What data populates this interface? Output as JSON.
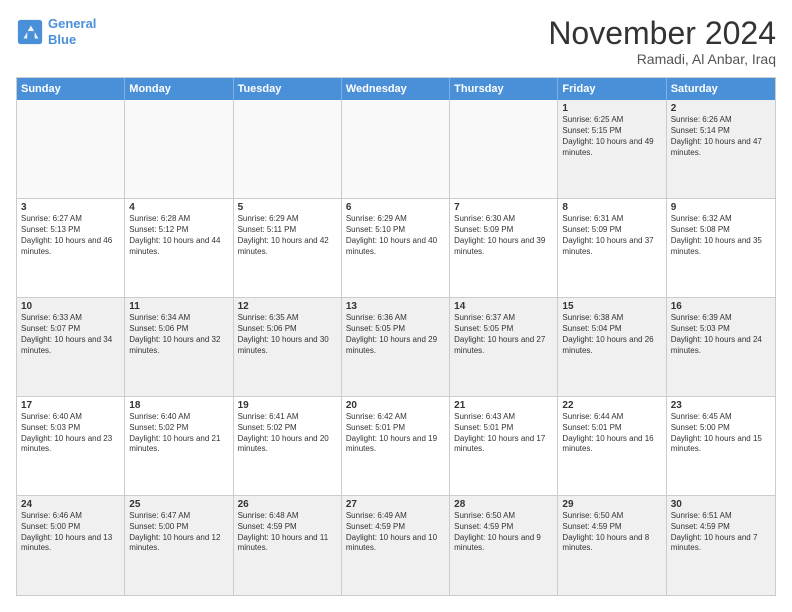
{
  "header": {
    "logo_line1": "General",
    "logo_line2": "Blue",
    "month_title": "November 2024",
    "location": "Ramadi, Al Anbar, Iraq"
  },
  "weekdays": [
    "Sunday",
    "Monday",
    "Tuesday",
    "Wednesday",
    "Thursday",
    "Friday",
    "Saturday"
  ],
  "weeks": [
    [
      {
        "day": "",
        "empty": true
      },
      {
        "day": "",
        "empty": true
      },
      {
        "day": "",
        "empty": true
      },
      {
        "day": "",
        "empty": true
      },
      {
        "day": "",
        "empty": true
      },
      {
        "day": "1",
        "rise": "6:25 AM",
        "set": "5:15 PM",
        "daylight": "10 hours and 49 minutes."
      },
      {
        "day": "2",
        "rise": "6:26 AM",
        "set": "5:14 PM",
        "daylight": "10 hours and 47 minutes."
      }
    ],
    [
      {
        "day": "3",
        "rise": "6:27 AM",
        "set": "5:13 PM",
        "daylight": "10 hours and 46 minutes."
      },
      {
        "day": "4",
        "rise": "6:28 AM",
        "set": "5:12 PM",
        "daylight": "10 hours and 44 minutes."
      },
      {
        "day": "5",
        "rise": "6:29 AM",
        "set": "5:11 PM",
        "daylight": "10 hours and 42 minutes."
      },
      {
        "day": "6",
        "rise": "6:29 AM",
        "set": "5:10 PM",
        "daylight": "10 hours and 40 minutes."
      },
      {
        "day": "7",
        "rise": "6:30 AM",
        "set": "5:09 PM",
        "daylight": "10 hours and 39 minutes."
      },
      {
        "day": "8",
        "rise": "6:31 AM",
        "set": "5:09 PM",
        "daylight": "10 hours and 37 minutes."
      },
      {
        "day": "9",
        "rise": "6:32 AM",
        "set": "5:08 PM",
        "daylight": "10 hours and 35 minutes."
      }
    ],
    [
      {
        "day": "10",
        "rise": "6:33 AM",
        "set": "5:07 PM",
        "daylight": "10 hours and 34 minutes."
      },
      {
        "day": "11",
        "rise": "6:34 AM",
        "set": "5:06 PM",
        "daylight": "10 hours and 32 minutes."
      },
      {
        "day": "12",
        "rise": "6:35 AM",
        "set": "5:06 PM",
        "daylight": "10 hours and 30 minutes."
      },
      {
        "day": "13",
        "rise": "6:36 AM",
        "set": "5:05 PM",
        "daylight": "10 hours and 29 minutes."
      },
      {
        "day": "14",
        "rise": "6:37 AM",
        "set": "5:05 PM",
        "daylight": "10 hours and 27 minutes."
      },
      {
        "day": "15",
        "rise": "6:38 AM",
        "set": "5:04 PM",
        "daylight": "10 hours and 26 minutes."
      },
      {
        "day": "16",
        "rise": "6:39 AM",
        "set": "5:03 PM",
        "daylight": "10 hours and 24 minutes."
      }
    ],
    [
      {
        "day": "17",
        "rise": "6:40 AM",
        "set": "5:03 PM",
        "daylight": "10 hours and 23 minutes."
      },
      {
        "day": "18",
        "rise": "6:40 AM",
        "set": "5:02 PM",
        "daylight": "10 hours and 21 minutes."
      },
      {
        "day": "19",
        "rise": "6:41 AM",
        "set": "5:02 PM",
        "daylight": "10 hours and 20 minutes."
      },
      {
        "day": "20",
        "rise": "6:42 AM",
        "set": "5:01 PM",
        "daylight": "10 hours and 19 minutes."
      },
      {
        "day": "21",
        "rise": "6:43 AM",
        "set": "5:01 PM",
        "daylight": "10 hours and 17 minutes."
      },
      {
        "day": "22",
        "rise": "6:44 AM",
        "set": "5:01 PM",
        "daylight": "10 hours and 16 minutes."
      },
      {
        "day": "23",
        "rise": "6:45 AM",
        "set": "5:00 PM",
        "daylight": "10 hours and 15 minutes."
      }
    ],
    [
      {
        "day": "24",
        "rise": "6:46 AM",
        "set": "5:00 PM",
        "daylight": "10 hours and 13 minutes."
      },
      {
        "day": "25",
        "rise": "6:47 AM",
        "set": "5:00 PM",
        "daylight": "10 hours and 12 minutes."
      },
      {
        "day": "26",
        "rise": "6:48 AM",
        "set": "4:59 PM",
        "daylight": "10 hours and 11 minutes."
      },
      {
        "day": "27",
        "rise": "6:49 AM",
        "set": "4:59 PM",
        "daylight": "10 hours and 10 minutes."
      },
      {
        "day": "28",
        "rise": "6:50 AM",
        "set": "4:59 PM",
        "daylight": "10 hours and 9 minutes."
      },
      {
        "day": "29",
        "rise": "6:50 AM",
        "set": "4:59 PM",
        "daylight": "10 hours and 8 minutes."
      },
      {
        "day": "30",
        "rise": "6:51 AM",
        "set": "4:59 PM",
        "daylight": "10 hours and 7 minutes."
      }
    ]
  ]
}
